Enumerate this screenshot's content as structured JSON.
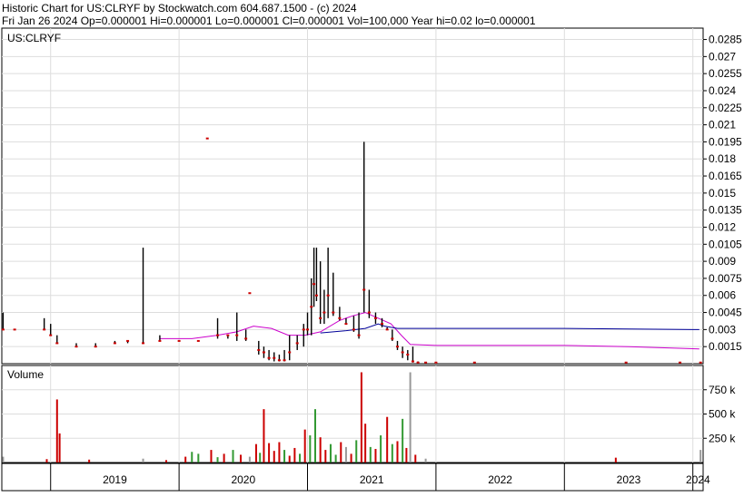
{
  "header": {
    "line1": "Historic Chart for US:CLRYF by Stockwatch.com 604.687.1500 - (c) 2024",
    "line2": "Fri Jan 26 2024   Op=0.000001   Hi=0.000001   Lo=0.000001   Cl=0.000001   Vol=100,000   Year hi=0.02   lo=0.000001"
  },
  "chart_data": [
    {
      "type": "line",
      "title": "US:CLRYF",
      "ylim": [
        0,
        0.0295
      ],
      "y_ticks": [
        "0.0285",
        "0.027",
        "0.0255",
        "0.024",
        "0.0225",
        "0.021",
        "0.0195",
        "0.018",
        "0.0165",
        "0.015",
        "0.0135",
        "0.012",
        "0.0105",
        "0.009",
        "0.0075",
        "0.006",
        "0.0045",
        "0.003",
        "0.0015"
      ],
      "y_tick_values": [
        0.0285,
        0.027,
        0.0255,
        0.024,
        0.0225,
        0.021,
        0.0195,
        0.018,
        0.0165,
        0.015,
        0.0135,
        0.012,
        0.0105,
        0.009,
        0.0075,
        0.006,
        0.0045,
        0.003,
        0.0015
      ],
      "x_categories": [
        "2019",
        "2020",
        "2021",
        "2022",
        "2023",
        "2024"
      ],
      "x_range": [
        2018.62,
        2024.08
      ],
      "grid": true,
      "price_bars": [
        {
          "x": 2018.63,
          "high": 0.0045,
          "low": 0.003,
          "close": 0.003
        },
        {
          "x": 2018.72,
          "high": 0.003,
          "low": 0.003,
          "close": 0.003
        },
        {
          "x": 2018.95,
          "high": 0.004,
          "low": 0.003,
          "close": 0.003
        },
        {
          "x": 2019.0,
          "high": 0.0035,
          "low": 0.0025,
          "close": 0.0025
        },
        {
          "x": 2019.05,
          "high": 0.0025,
          "low": 0.0018,
          "close": 0.0018
        },
        {
          "x": 2019.2,
          "high": 0.0018,
          "low": 0.0015,
          "close": 0.0015
        },
        {
          "x": 2019.35,
          "high": 0.0018,
          "low": 0.0015,
          "close": 0.0015
        },
        {
          "x": 2019.5,
          "high": 0.002,
          "low": 0.0018,
          "close": 0.0018
        },
        {
          "x": 2019.6,
          "high": 0.002,
          "low": 0.0018,
          "close": 0.002
        },
        {
          "x": 2019.72,
          "high": 0.0102,
          "low": 0.0018,
          "close": 0.0018
        },
        {
          "x": 2019.85,
          "high": 0.0025,
          "low": 0.002,
          "close": 0.002
        },
        {
          "x": 2020.0,
          "high": 0.002,
          "low": 0.002,
          "close": 0.002
        },
        {
          "x": 2020.15,
          "high": 0.002,
          "low": 0.002,
          "close": 0.002
        },
        {
          "x": 2020.22,
          "high": 0.0198,
          "low": 0.0198,
          "close": 0.0198
        },
        {
          "x": 2020.3,
          "high": 0.004,
          "low": 0.0022,
          "close": 0.0025
        },
        {
          "x": 2020.38,
          "high": 0.0025,
          "low": 0.0022,
          "close": 0.0025
        },
        {
          "x": 2020.45,
          "high": 0.0045,
          "low": 0.002,
          "close": 0.0025
        },
        {
          "x": 2020.52,
          "high": 0.003,
          "low": 0.002,
          "close": 0.0022
        },
        {
          "x": 2020.55,
          "high": 0.0062,
          "low": 0.0062,
          "close": 0.0062
        },
        {
          "x": 2020.62,
          "high": 0.002,
          "low": 0.0008,
          "close": 0.0012
        },
        {
          "x": 2020.66,
          "high": 0.0015,
          "low": 0.0005,
          "close": 0.001
        },
        {
          "x": 2020.7,
          "high": 0.0012,
          "low": 0.0003,
          "close": 0.0005
        },
        {
          "x": 2020.74,
          "high": 0.001,
          "low": 0.0002,
          "close": 0.0005
        },
        {
          "x": 2020.78,
          "high": 0.0008,
          "low": 0.0002,
          "close": 0.0003
        },
        {
          "x": 2020.82,
          "high": 0.0012,
          "low": 0.0002,
          "close": 0.0003
        },
        {
          "x": 2020.86,
          "high": 0.0025,
          "low": 0.0003,
          "close": 0.001
        },
        {
          "x": 2020.92,
          "high": 0.0025,
          "low": 0.0012,
          "close": 0.0018
        },
        {
          "x": 2020.97,
          "high": 0.0035,
          "low": 0.0015,
          "close": 0.003
        },
        {
          "x": 2021.0,
          "high": 0.0045,
          "low": 0.0025,
          "close": 0.003
        },
        {
          "x": 2021.03,
          "high": 0.0075,
          "low": 0.0025,
          "close": 0.005
        },
        {
          "x": 2021.05,
          "high": 0.0102,
          "low": 0.005,
          "close": 0.007
        },
        {
          "x": 2021.07,
          "high": 0.0102,
          "low": 0.0055,
          "close": 0.006
        },
        {
          "x": 2021.1,
          "high": 0.009,
          "low": 0.0035,
          "close": 0.004
        },
        {
          "x": 2021.13,
          "high": 0.0065,
          "low": 0.0035,
          "close": 0.0045
        },
        {
          "x": 2021.16,
          "high": 0.0102,
          "low": 0.004,
          "close": 0.006
        },
        {
          "x": 2021.2,
          "high": 0.008,
          "low": 0.0042,
          "close": 0.0045
        },
        {
          "x": 2021.25,
          "high": 0.005,
          "low": 0.0038,
          "close": 0.004
        },
        {
          "x": 2021.3,
          "high": 0.004,
          "low": 0.0035,
          "close": 0.0035
        },
        {
          "x": 2021.36,
          "high": 0.0042,
          "low": 0.0028,
          "close": 0.003
        },
        {
          "x": 2021.4,
          "high": 0.0045,
          "low": 0.0022,
          "close": 0.0025
        },
        {
          "x": 2021.44,
          "high": 0.0195,
          "low": 0.0045,
          "close": 0.0065
        },
        {
          "x": 2021.48,
          "high": 0.0065,
          "low": 0.004,
          "close": 0.0045
        },
        {
          "x": 2021.53,
          "high": 0.0045,
          "low": 0.0035,
          "close": 0.004
        },
        {
          "x": 2021.58,
          "high": 0.004,
          "low": 0.0032,
          "close": 0.0035
        },
        {
          "x": 2021.62,
          "high": 0.0032,
          "low": 0.003,
          "close": 0.003
        },
        {
          "x": 2021.66,
          "high": 0.003,
          "low": 0.002,
          "close": 0.0022
        },
        {
          "x": 2021.7,
          "high": 0.002,
          "low": 0.0012,
          "close": 0.0015
        },
        {
          "x": 2021.74,
          "high": 0.0015,
          "low": 0.0005,
          "close": 0.001
        },
        {
          "x": 2021.78,
          "high": 0.0012,
          "low": 0.0003,
          "close": 0.0008
        },
        {
          "x": 2021.82,
          "high": 0.0015,
          "low": 0.0001,
          "close": 0.0002
        },
        {
          "x": 2021.86,
          "high": 0.0002,
          "low": 0.0001,
          "close": 0.0001
        },
        {
          "x": 2021.92,
          "high": 0.0001,
          "low": 0.0001,
          "close": 0.0001
        },
        {
          "x": 2022.0,
          "high": 0.0001,
          "low": 0.0001,
          "close": 0.0001
        },
        {
          "x": 2022.3,
          "high": 0.0001,
          "low": 0.0001,
          "close": 0.0001
        },
        {
          "x": 2023.48,
          "high": 0.0001,
          "low": 0.0001,
          "close": 0.0001
        },
        {
          "x": 2023.9,
          "high": 0.0001,
          "low": 0.0001,
          "close": 0.0001
        },
        {
          "x": 2024.06,
          "high": 0.0001,
          "low": 0.0001,
          "close": 0.0001
        }
      ],
      "series": [
        {
          "color": "#cc00cc",
          "points": [
            [
              2019.85,
              0.0022
            ],
            [
              2020.1,
              0.0022
            ],
            [
              2020.3,
              0.0025
            ],
            [
              2020.45,
              0.0028
            ],
            [
              2020.58,
              0.0033
            ],
            [
              2020.72,
              0.0031
            ],
            [
              2020.85,
              0.0025
            ],
            [
              2020.98,
              0.0025
            ],
            [
              2021.1,
              0.0028
            ],
            [
              2021.25,
              0.0038
            ],
            [
              2021.35,
              0.0042
            ],
            [
              2021.45,
              0.0045
            ],
            [
              2021.55,
              0.004
            ],
            [
              2021.65,
              0.0035
            ],
            [
              2021.73,
              0.0025
            ],
            [
              2021.8,
              0.0017
            ],
            [
              2022.0,
              0.0016
            ],
            [
              2022.5,
              0.0016
            ],
            [
              2023.0,
              0.0016
            ],
            [
              2023.5,
              0.0015
            ],
            [
              2024.05,
              0.0013
            ]
          ]
        },
        {
          "color": "#000099",
          "points": [
            [
              2021.1,
              0.0027
            ],
            [
              2021.3,
              0.0029
            ],
            [
              2021.45,
              0.0031
            ],
            [
              2021.55,
              0.0035
            ],
            [
              2021.6,
              0.0033
            ],
            [
              2021.7,
              0.0031
            ],
            [
              2022.0,
              0.0031
            ],
            [
              2023.0,
              0.0031
            ],
            [
              2024.05,
              0.003
            ]
          ]
        }
      ]
    },
    {
      "type": "bar",
      "title": "Volume",
      "ylim": [
        0,
        1000000
      ],
      "y_ticks": [
        "750 k",
        "500 k",
        "250 k"
      ],
      "y_tick_values": [
        750000,
        500000,
        250000
      ],
      "bars": [
        {
          "x": 2018.63,
          "v": 60000,
          "c": "#999999"
        },
        {
          "x": 2018.97,
          "v": 35000,
          "c": "#cc0000"
        },
        {
          "x": 2019.05,
          "v": 650000,
          "c": "#cc0000"
        },
        {
          "x": 2019.07,
          "v": 300000,
          "c": "#cc0000"
        },
        {
          "x": 2019.3,
          "v": 30000,
          "c": "#cc0000"
        },
        {
          "x": 2019.72,
          "v": 40000,
          "c": "#999999"
        },
        {
          "x": 2019.9,
          "v": 25000,
          "c": "#cc0000"
        },
        {
          "x": 2020.05,
          "v": 60000,
          "c": "#cc0000"
        },
        {
          "x": 2020.1,
          "v": 110000,
          "c": "#339933"
        },
        {
          "x": 2020.15,
          "v": 90000,
          "c": "#339933"
        },
        {
          "x": 2020.25,
          "v": 130000,
          "c": "#cc0000"
        },
        {
          "x": 2020.3,
          "v": 55000,
          "c": "#339933"
        },
        {
          "x": 2020.35,
          "v": 90000,
          "c": "#cc0000"
        },
        {
          "x": 2020.42,
          "v": 130000,
          "c": "#339933"
        },
        {
          "x": 2020.48,
          "v": 80000,
          "c": "#cc0000"
        },
        {
          "x": 2020.55,
          "v": 60000,
          "c": "#999999"
        },
        {
          "x": 2020.6,
          "v": 190000,
          "c": "#cc0000"
        },
        {
          "x": 2020.63,
          "v": 100000,
          "c": "#339933"
        },
        {
          "x": 2020.66,
          "v": 550000,
          "c": "#cc0000"
        },
        {
          "x": 2020.7,
          "v": 200000,
          "c": "#cc0000"
        },
        {
          "x": 2020.74,
          "v": 120000,
          "c": "#cc0000"
        },
        {
          "x": 2020.78,
          "v": 210000,
          "c": "#cc0000"
        },
        {
          "x": 2020.82,
          "v": 130000,
          "c": "#339933"
        },
        {
          "x": 2020.86,
          "v": 70000,
          "c": "#cc0000"
        },
        {
          "x": 2020.9,
          "v": 150000,
          "c": "#cc0000"
        },
        {
          "x": 2020.94,
          "v": 90000,
          "c": "#339933"
        },
        {
          "x": 2020.98,
          "v": 340000,
          "c": "#cc0000"
        },
        {
          "x": 2021.02,
          "v": 280000,
          "c": "#339933"
        },
        {
          "x": 2021.06,
          "v": 550000,
          "c": "#339933"
        },
        {
          "x": 2021.1,
          "v": 260000,
          "c": "#cc0000"
        },
        {
          "x": 2021.14,
          "v": 130000,
          "c": "#cc0000"
        },
        {
          "x": 2021.18,
          "v": 190000,
          "c": "#339933"
        },
        {
          "x": 2021.22,
          "v": 80000,
          "c": "#339933"
        },
        {
          "x": 2021.26,
          "v": 210000,
          "c": "#cc0000"
        },
        {
          "x": 2021.3,
          "v": 160000,
          "c": "#999999"
        },
        {
          "x": 2021.34,
          "v": 90000,
          "c": "#cc0000"
        },
        {
          "x": 2021.38,
          "v": 230000,
          "c": "#339933"
        },
        {
          "x": 2021.42,
          "v": 930000,
          "c": "#cc0000"
        },
        {
          "x": 2021.45,
          "v": 400000,
          "c": "#cc0000"
        },
        {
          "x": 2021.49,
          "v": 160000,
          "c": "#339933"
        },
        {
          "x": 2021.53,
          "v": 140000,
          "c": "#cc0000"
        },
        {
          "x": 2021.57,
          "v": 280000,
          "c": "#339933"
        },
        {
          "x": 2021.62,
          "v": 470000,
          "c": "#cc0000"
        },
        {
          "x": 2021.66,
          "v": 190000,
          "c": "#339933"
        },
        {
          "x": 2021.7,
          "v": 220000,
          "c": "#cc0000"
        },
        {
          "x": 2021.74,
          "v": 450000,
          "c": "#339933"
        },
        {
          "x": 2021.77,
          "v": 150000,
          "c": "#cc0000"
        },
        {
          "x": 2021.8,
          "v": 930000,
          "c": "#999999"
        },
        {
          "x": 2021.84,
          "v": 80000,
          "c": "#cc0000"
        },
        {
          "x": 2021.92,
          "v": 40000,
          "c": "#999999"
        },
        {
          "x": 2023.4,
          "v": 50000,
          "c": "#cc0000"
        },
        {
          "x": 2024.06,
          "v": 130000,
          "c": "#999999"
        }
      ]
    }
  ]
}
